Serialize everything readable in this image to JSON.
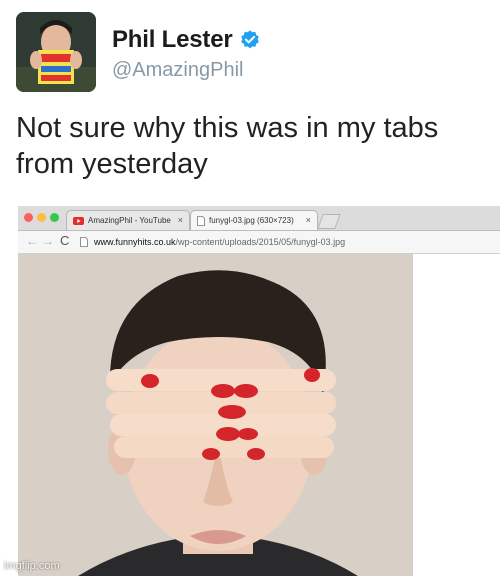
{
  "tweet": {
    "display_name": "Phil Lester",
    "handle": "@AmazingPhil",
    "text_lines": [
      "Not sure why this was in my tabs",
      "from yesterday"
    ],
    "verified_icon": "verified-badge-icon",
    "accent_color": "#1da1f2"
  },
  "browser": {
    "tabs": [
      {
        "label": "AmazingPhil - YouTube",
        "icon": "youtube-icon",
        "close": "×"
      },
      {
        "label": "funygl-03.jpg (630×723)",
        "icon": "document-icon",
        "close": "×"
      }
    ],
    "url_host": "www.funnyhits.co.uk",
    "url_path": "/wp-content/uploads/2015/05/funygl-03.jpg",
    "nav": {
      "back": "←",
      "forward": "→",
      "reload": "C"
    },
    "traffic_colors": [
      "#fc605b",
      "#fdbc40",
      "#34c84a"
    ]
  },
  "watermark": "imgflip.com"
}
